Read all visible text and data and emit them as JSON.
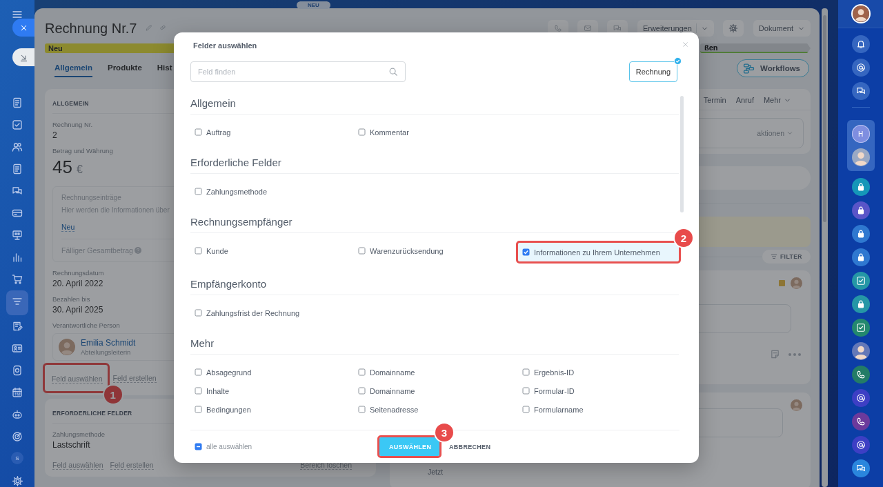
{
  "top_badge": "NEU",
  "left_sidebar": {
    "user_initial": "S"
  },
  "right_sidebar": {
    "group_initial": "H"
  },
  "page": {
    "title": "Rechnung Nr.7",
    "extensions_button": "Erweiterungen",
    "document_button": "Dokument",
    "stages": [
      {
        "label": "Neu",
        "selected": true
      },
      {
        "label": "ßen",
        "selected": false
      }
    ],
    "tabs": [
      {
        "label": "Allgemein",
        "selected": true
      },
      {
        "label": "Produkte",
        "selected": false
      },
      {
        "label": "Hist",
        "selected": false
      }
    ],
    "workflows_button": "Workflows"
  },
  "general_card": {
    "heading": "ALLGEMEIN",
    "fields": [
      {
        "label": "Rechnung Nr.",
        "value": "2"
      }
    ],
    "amount": {
      "label": "Betrag und Währung",
      "value": "45",
      "unit": "€"
    },
    "items_box": {
      "title": "Rechnungseinträge",
      "text": "Hier werden die Informationen über",
      "link": "Neu",
      "total_label": "Fälliger Gesamtbetrag"
    },
    "dates": [
      {
        "label": "Rechnungsdatum",
        "value": "20. April 2022"
      },
      {
        "label": "Bezahlen bis",
        "value": "30. April 2025"
      }
    ],
    "responsible": {
      "label": "Verantwortliche Person",
      "name": "Emilia Schmidt",
      "role": "Abteilungsleiterin"
    },
    "links": [
      {
        "label": "Feld auswählen",
        "callout": "1"
      },
      {
        "label": "Feld erstellen"
      }
    ]
  },
  "required_card": {
    "heading": "ERFORDERLICHE FELDER",
    "field": {
      "label": "Zahlungsmethode",
      "value": "Lastschrift"
    },
    "links": [
      {
        "label": "Feld auswählen"
      },
      {
        "label": "Feld erstellen"
      }
    ],
    "delete_link": "Bereich löschen"
  },
  "activity": {
    "tabs": [
      "Termin",
      "Anruf",
      "Mehr"
    ],
    "actions_button": "aktionen",
    "filter_button": "FILTER",
    "feed_time": "Jetzt"
  },
  "dialog": {
    "title": "Felder auswählen",
    "search_placeholder": "Feld finden",
    "entity_chip": {
      "label": "Rechnung",
      "selected": true
    },
    "sections": [
      {
        "heading": "Allgemein",
        "fields": [
          {
            "label": "Auftrag",
            "checked": false
          },
          {
            "label": "Kommentar",
            "checked": false
          }
        ]
      },
      {
        "heading": "Erforderliche Felder",
        "fields": [
          {
            "label": "Zahlungsmethode",
            "checked": false
          }
        ]
      },
      {
        "heading": "Rechnungsempfänger",
        "fields": [
          {
            "label": "Kunde",
            "checked": false
          },
          {
            "label": "Warenzurücksendung",
            "checked": false
          },
          {
            "label": "Informationen zu Ihrem Unternehmen",
            "checked": true,
            "callout": "2"
          }
        ]
      },
      {
        "heading": "Empfängerkonto",
        "fields": [
          {
            "label": "Zahlungsfrist der Rechnung",
            "checked": false
          }
        ]
      },
      {
        "heading": "Mehr",
        "fields": [
          {
            "label": "Absagegrund",
            "checked": false
          },
          {
            "label": "Domainname",
            "checked": false
          },
          {
            "label": "Ergebnis-ID",
            "checked": false
          },
          {
            "label": "Inhalte",
            "checked": false
          },
          {
            "label": "Domainname",
            "checked": false
          },
          {
            "label": "Formular-ID",
            "checked": false
          },
          {
            "label": "Bedingungen",
            "checked": false
          },
          {
            "label": "Seitenadresse",
            "checked": false
          },
          {
            "label": "Formularname",
            "checked": false
          }
        ]
      }
    ],
    "select_all": {
      "label": "alle auswählen",
      "indeterminate": true
    },
    "buttons": [
      {
        "label": "AUSWÄHLEN",
        "kind": "primary",
        "callout": "3"
      },
      {
        "label": "ABBRECHEN",
        "kind": "text"
      }
    ]
  }
}
